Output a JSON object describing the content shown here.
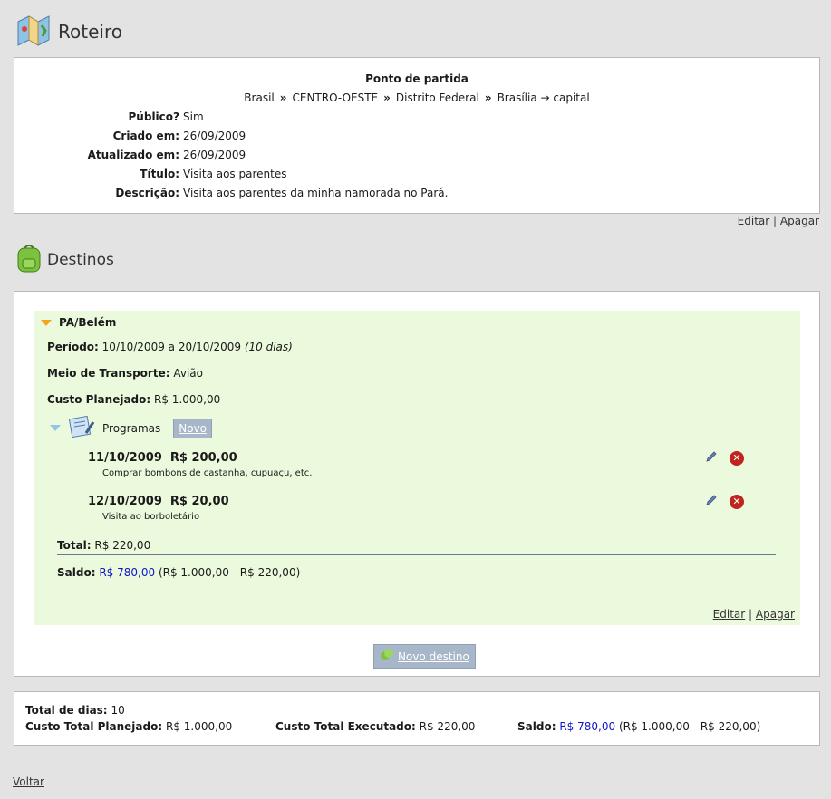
{
  "roteiro": {
    "heading": "Roteiro",
    "ponto_partida_title": "Ponto de partida",
    "breadcrumb": [
      "Brasil",
      "CENTRO-OESTE",
      "Distrito Federal",
      "Brasília → capital"
    ],
    "breadcrumb_sep": "»",
    "fields": [
      {
        "label": "Público?",
        "value": "Sim"
      },
      {
        "label": "Criado em:",
        "value": "26/09/2009"
      },
      {
        "label": "Atualizado em:",
        "value": "26/09/2009"
      },
      {
        "label": "Título:",
        "value": "Visita aos parentes"
      },
      {
        "label": "Descrição:",
        "value": "Visita aos parentes da minha namorada no Pará."
      }
    ],
    "edit_label": "Editar",
    "delete_label": "Apagar",
    "divider": "|"
  },
  "destinos": {
    "heading": "Destinos",
    "destination": {
      "name": "PA/Belém",
      "periodo_label": "Período:",
      "periodo_value": "10/10/2009 a 20/10/2009",
      "periodo_days": "(10 dias)",
      "transporte_label": "Meio de Transporte:",
      "transporte_value": "Avião",
      "custo_label": "Custo Planejado:",
      "custo_value": "R$ 1.000,00",
      "programas_label": "Programas",
      "novo_label": "Novo",
      "programas": [
        {
          "date": "11/10/2009",
          "amount": "R$ 200,00",
          "desc": "Comprar bombons de castanha, cupuaçu, etc."
        },
        {
          "date": "12/10/2009",
          "amount": "R$ 20,00",
          "desc": "Visita ao borboletário"
        }
      ],
      "total_label": "Total:",
      "total_value": "R$ 220,00",
      "saldo_label": "Saldo:",
      "saldo_value": "R$ 780,00",
      "saldo_calc": "(R$ 1.000,00 - R$ 220,00)",
      "edit_label": "Editar",
      "delete_label": "Apagar",
      "divider": "|"
    },
    "novo_destino_label": "Novo destino"
  },
  "totais": {
    "dias_label": "Total de dias:",
    "dias_value": "10",
    "planejado_label": "Custo Total Planejado:",
    "planejado_value": "R$ 1.000,00",
    "executado_label": "Custo Total Executado:",
    "executado_value": "R$ 220,00",
    "saldo_label": "Saldo:",
    "saldo_value": "R$ 780,00",
    "saldo_calc": "(R$ 1.000,00 - R$ 220,00)"
  },
  "voltar_label": "Voltar",
  "colors": {
    "accent_blue": "#1016c8",
    "panel_green": "#ebf9dc",
    "delete_red": "#c0241c"
  },
  "icons": [
    "map-icon",
    "backpack-icon",
    "expand-triangle-icon",
    "notebook-icon",
    "pencil-icon",
    "delete-icon",
    "leaf-icon"
  ]
}
